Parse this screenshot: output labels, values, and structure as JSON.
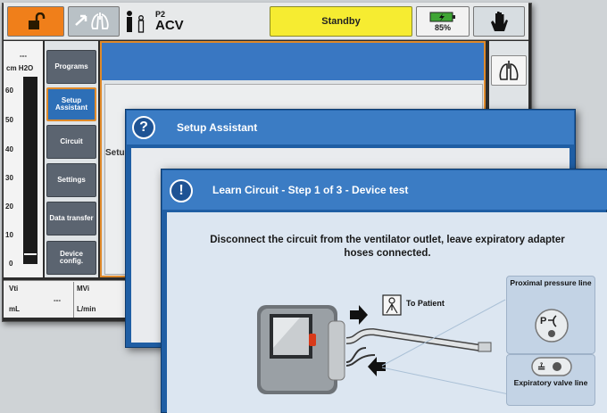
{
  "top_bar": {
    "patient_profile": "P2",
    "mode": "ACV",
    "status": "Standby",
    "battery_percent": "85%",
    "lock_color": "#f07f1a",
    "standby_color": "#f6ec31"
  },
  "pressure_gauge": {
    "unit": "cm H2O",
    "top_marker": "---",
    "ticks": [
      "60",
      "50",
      "40",
      "30",
      "20",
      "10",
      "0"
    ]
  },
  "menu": {
    "programs": "Programs",
    "setup_assistant": "Setup Assistant",
    "circuit": "Circuit",
    "settings": "Settings",
    "data_transfer": "Data transfer",
    "device_config": "Device config."
  },
  "bottom_bar": {
    "vti_label": "Vti",
    "vti_value": "---",
    "vti_unit": "mL",
    "mvi_label": "MVi",
    "mvi_unit": "L/min"
  },
  "dialog_setup": {
    "title": "Setup Assistant",
    "body_fragment": "Setu"
  },
  "dialog_learn": {
    "title": "Learn Circuit - Step 1 of 3 - Device test",
    "instruction_line1": "Disconnect the circuit from the ventilator outlet, leave expiratory adapter",
    "instruction_line2": "hoses connected.",
    "to_patient": "To Patient",
    "proximal_label": "Proximal pressure line",
    "expiratory_label": "Expiratory valve line",
    "accent_color": "#3b7cc4"
  }
}
